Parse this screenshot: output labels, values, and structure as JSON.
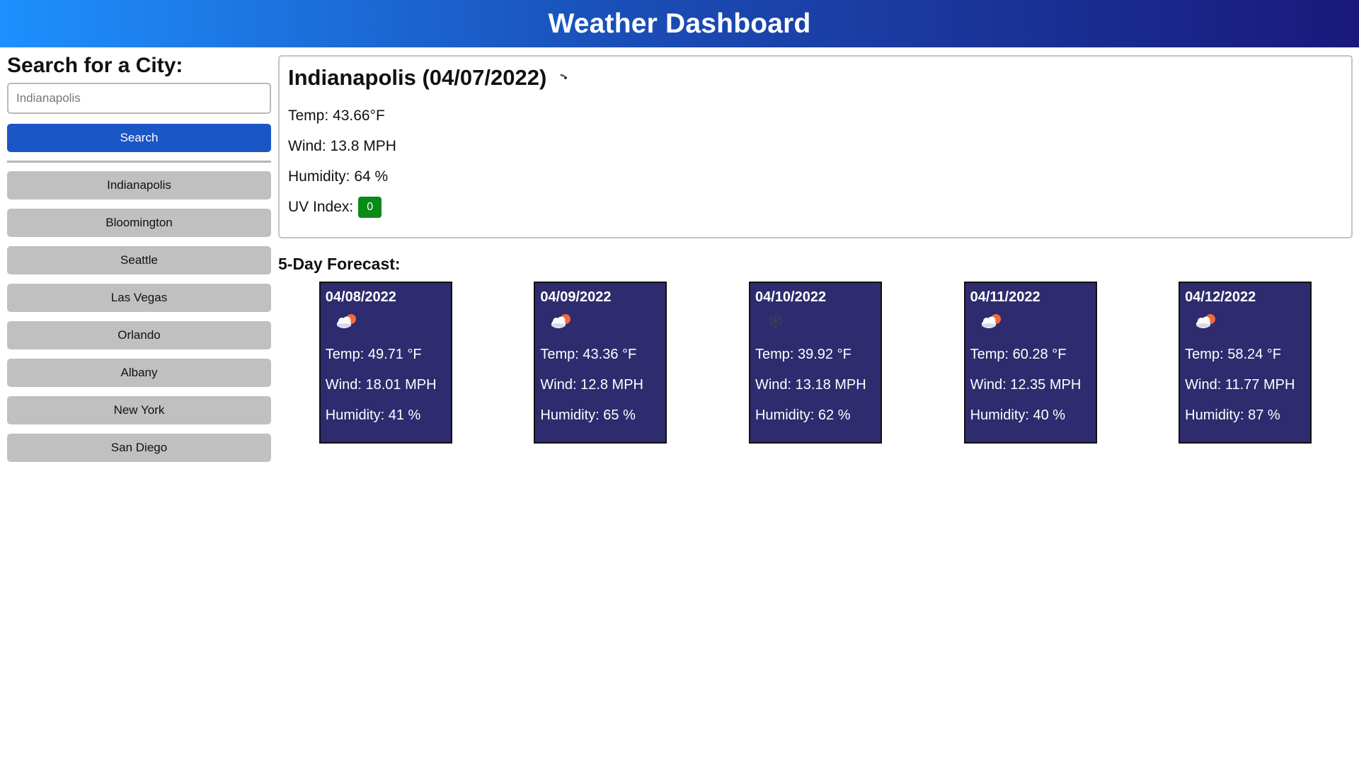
{
  "header": {
    "title": "Weather Dashboard"
  },
  "sidebar": {
    "heading": "Search for a City:",
    "search_placeholder": "Indianapolis",
    "search_button": "Search",
    "history": [
      "Indianapolis",
      "Bloomington",
      "Seattle",
      "Las Vegas",
      "Orlando",
      "Albany",
      "New York",
      "San Diego"
    ]
  },
  "current": {
    "title": "Indianapolis (04/07/2022)",
    "icon": "moon-icon",
    "temp": "Temp: 43.66°F",
    "wind": "Wind: 13.8 MPH",
    "humidity": "Humidity: 64 %",
    "uv_label": "UV Index:",
    "uv_value": "0",
    "uv_color": "#0a8a17"
  },
  "forecast": {
    "heading": "5-Day Forecast:",
    "days": [
      {
        "date": "04/08/2022",
        "icon": "cloud-sun-icon",
        "temp": "Temp: 49.71 °F",
        "wind": "Wind: 18.01 MPH",
        "humidity": "Humidity: 41 %"
      },
      {
        "date": "04/09/2022",
        "icon": "cloud-sun-icon",
        "temp": "Temp: 43.36 °F",
        "wind": "Wind: 12.8 MPH",
        "humidity": "Humidity: 65 %"
      },
      {
        "date": "04/10/2022",
        "icon": "snowflake-icon",
        "temp": "Temp: 39.92 °F",
        "wind": "Wind: 13.18 MPH",
        "humidity": "Humidity: 62 %"
      },
      {
        "date": "04/11/2022",
        "icon": "cloud-sun-icon",
        "temp": "Temp: 60.28 °F",
        "wind": "Wind: 12.35 MPH",
        "humidity": "Humidity: 40 %"
      },
      {
        "date": "04/12/2022",
        "icon": "cloud-sun-icon",
        "temp": "Temp: 58.24 °F",
        "wind": "Wind: 11.77 MPH",
        "humidity": "Humidity: 87 %"
      }
    ]
  },
  "colors": {
    "header_gradient_start": "#1e90ff",
    "header_gradient_end": "#19197a",
    "search_button": "#1a56c4",
    "card_background": "#2e2b6e",
    "history_button": "#c0c0c0"
  }
}
